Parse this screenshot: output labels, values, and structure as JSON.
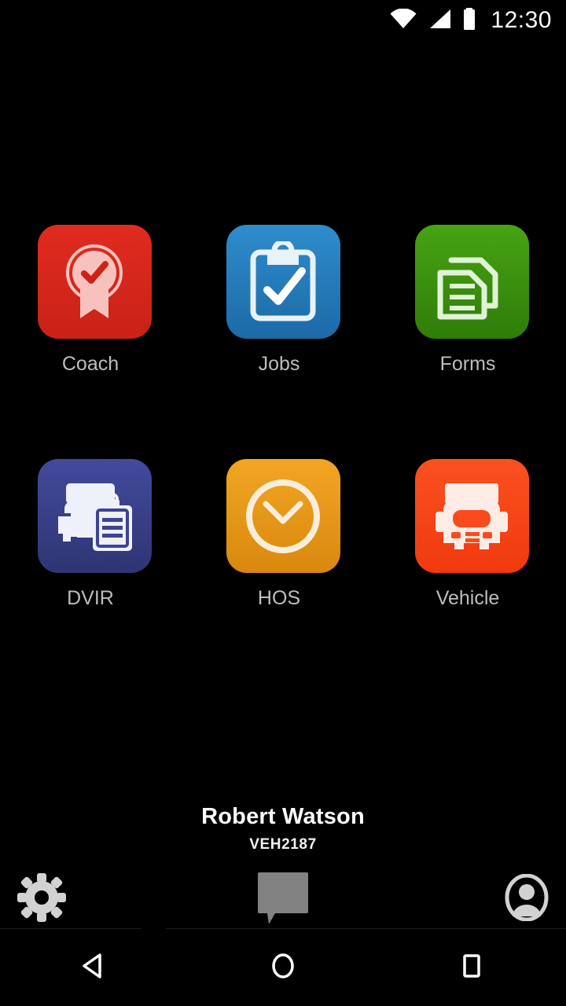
{
  "status_bar": {
    "time": "12:30",
    "icons": [
      "wifi-icon",
      "cellular-signal-icon",
      "battery-icon"
    ]
  },
  "apps": [
    {
      "label": "Coach",
      "icon": "award-badge-icon",
      "color": "#e02b20",
      "color_bottom": "#c42017",
      "icon_color": "#f7c2bd"
    },
    {
      "label": "Jobs",
      "icon": "clipboard-check-icon",
      "color": "#2a86c8",
      "color_bottom": "#1d6ca8",
      "icon_color": "#e8f2f9"
    },
    {
      "label": "Forms",
      "icon": "documents-icon",
      "color": "#3f9a10",
      "color_bottom": "#2f7d08",
      "icon_color": "#e2f2d7"
    },
    {
      "label": "DVIR",
      "icon": "truck-clipboard-icon",
      "color": "#3d4492",
      "color_bottom": "#303776",
      "icon_color": "#eef0fa"
    },
    {
      "label": "HOS",
      "icon": "clock-icon",
      "color": "#efa01e",
      "color_bottom": "#d98b12",
      "icon_color": "#faeedb"
    },
    {
      "label": "Vehicle",
      "icon": "truck-front-icon",
      "color": "#fb4a1c",
      "color_bottom": "#f03c10",
      "icon_color": "#fdece5"
    }
  ],
  "user": {
    "name": "Robert Watson",
    "vehicle_id": "VEH2187"
  },
  "app_bar": {
    "settings": {
      "icon": "gear-icon",
      "color": "#d2d2d2"
    },
    "messages": {
      "icon": "speech-bubble-icon",
      "color": "#828282"
    },
    "profile": {
      "icon": "user-avatar-icon",
      "color": "#d2d2d2"
    }
  },
  "nav_bar": {
    "back": "back-triangle-icon",
    "home": "home-circle-icon",
    "recents": "recents-square-icon"
  }
}
